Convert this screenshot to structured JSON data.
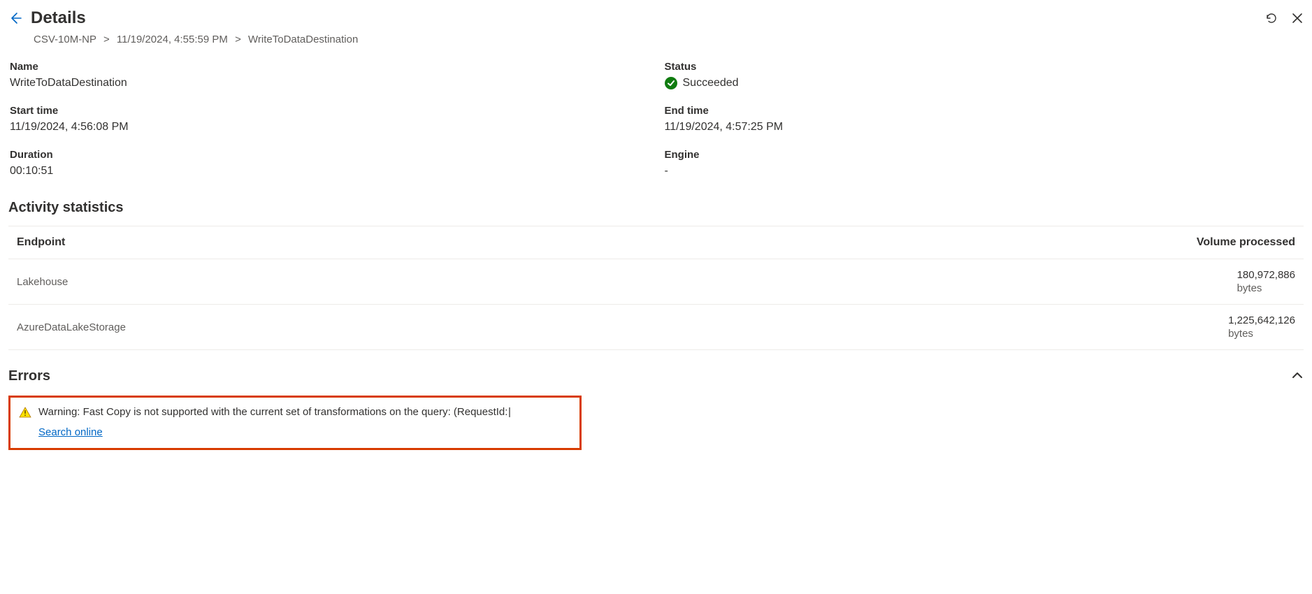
{
  "header": {
    "title": "Details",
    "breadcrumb": {
      "a": "CSV-10M-NP",
      "b": "11/19/2024, 4:55:59 PM",
      "c": "WriteToDataDestination"
    }
  },
  "info": {
    "name_label": "Name",
    "name_value": "WriteToDataDestination",
    "status_label": "Status",
    "status_value": "Succeeded",
    "start_label": "Start time",
    "start_value": "11/19/2024, 4:56:08 PM",
    "end_label": "End time",
    "end_value": "11/19/2024, 4:57:25 PM",
    "duration_label": "Duration",
    "duration_value": "00:10:51",
    "engine_label": "Engine",
    "engine_value": "-"
  },
  "activity": {
    "title": "Activity statistics",
    "col_endpoint": "Endpoint",
    "col_volume": "Volume processed",
    "rows": [
      {
        "endpoint": "Lakehouse",
        "volume_num": "180,972,886",
        "volume_unit": "bytes"
      },
      {
        "endpoint": "AzureDataLakeStorage",
        "volume_num": "1,225,642,126",
        "volume_unit": "bytes"
      }
    ]
  },
  "errors": {
    "title": "Errors",
    "warning_text": "Warning: Fast Copy is not supported with the current set of transformations on the query: (RequestId:",
    "search_link": "Search online"
  }
}
